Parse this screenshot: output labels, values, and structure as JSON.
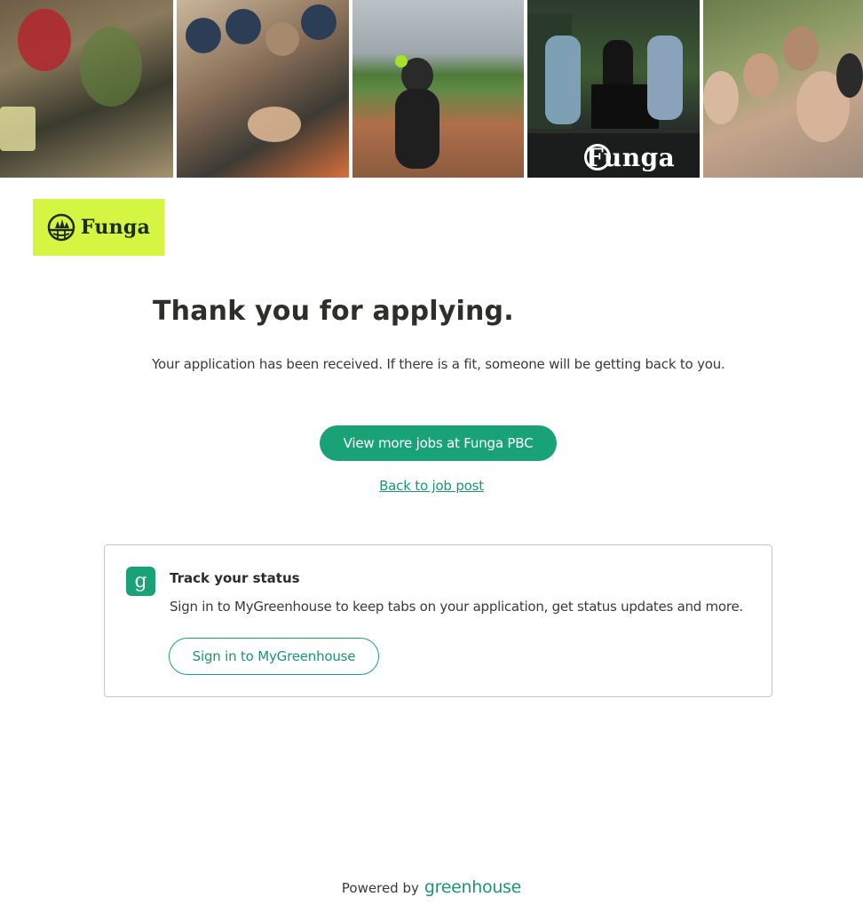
{
  "banner": {
    "photos": [
      "planting-photo",
      "team-huddle-photo",
      "field-worker-photo",
      "event-booth-photo",
      "group-selfie-photo"
    ],
    "booth_sign": "Funga"
  },
  "logo": {
    "text": "Funga",
    "bg_color": "#d4f542"
  },
  "confirmation": {
    "title": "Thank you for applying.",
    "message": "Your application has been received. If there is a fit, someone will be getting back to you."
  },
  "actions": {
    "more_jobs_label": "View more jobs at Funga PBC",
    "back_link_label": "Back to job post"
  },
  "status_card": {
    "icon_glyph": "g",
    "title": "Track your status",
    "text": "Sign in to MyGreenhouse to keep tabs on your application, get status updates and more.",
    "sign_in_label": "Sign in to MyGreenhouse"
  },
  "footer": {
    "powered_by": "Powered by",
    "brand": "greenhouse"
  },
  "colors": {
    "accent": "#1aa277",
    "text": "#2b2b2b",
    "border": "#c7c7c7"
  }
}
